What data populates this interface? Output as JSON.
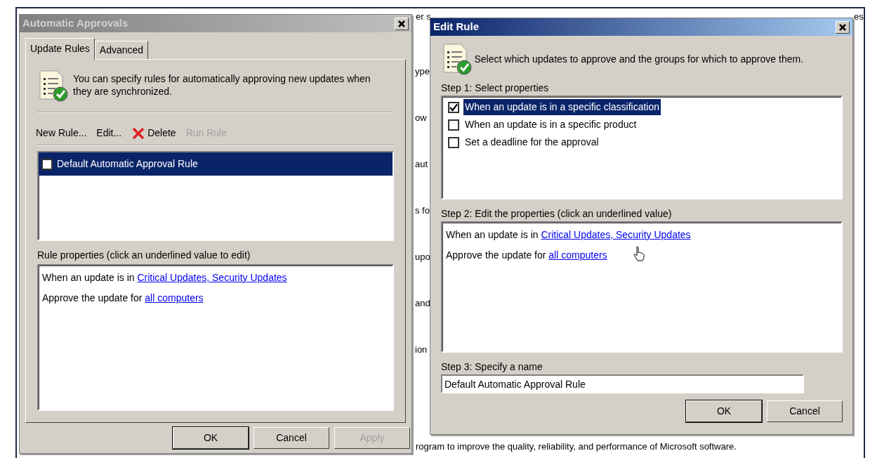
{
  "background": {
    "top_fragments": [
      "er s",
      "es"
    ],
    "side_fragments": [
      "ype",
      "ow",
      "aut",
      "s fo",
      "upo",
      "and",
      "ion"
    ],
    "footer_text": "rogram to improve the quality, reliability, and performance of Microsoft software."
  },
  "automatic_approvals": {
    "title": "Automatic Approvals",
    "active": false,
    "tabs": [
      {
        "label": "Update Rules",
        "selected": true
      },
      {
        "label": "Advanced",
        "selected": false
      }
    ],
    "intro": "You can specify rules for automatically approving new updates when they are synchronized.",
    "toolbar": [
      {
        "label": "New Rule...",
        "kind": "text",
        "disabled": false
      },
      {
        "label": "Edit...",
        "kind": "text",
        "disabled": false
      },
      {
        "label": "Delete",
        "kind": "delete",
        "disabled": false
      },
      {
        "label": "Run Rule",
        "kind": "text",
        "disabled": true
      }
    ],
    "rules": [
      {
        "label": "Default Automatic Approval Rule",
        "checked": false,
        "selected": true
      }
    ],
    "properties_label": "Rule properties (click an underlined value to edit)",
    "properties": [
      {
        "text": "When an update is in",
        "link": "Critical Updates, Security Updates"
      },
      {
        "text": "Approve the update for",
        "link": "all computers"
      }
    ],
    "buttons": [
      {
        "label": "OK",
        "default": true,
        "disabled": false
      },
      {
        "label": "Cancel",
        "default": false,
        "disabled": false
      },
      {
        "label": "Apply",
        "default": false,
        "disabled": true
      }
    ]
  },
  "edit_rule": {
    "title": "Edit Rule",
    "active": true,
    "intro": "Select which updates to approve and the groups for which to approve them.",
    "step1_label": "Step 1: Select properties",
    "options": [
      {
        "label": "When an update is in a specific classification",
        "checked": true,
        "selected": true
      },
      {
        "label": "When an update is in a specific product",
        "checked": false,
        "selected": false
      },
      {
        "label": "Set a deadline for the approval",
        "checked": false,
        "selected": false
      }
    ],
    "step2_label": "Step 2: Edit the properties (click an underlined value)",
    "properties": [
      {
        "text": "When an update is in",
        "link": "Critical Updates, Security Updates"
      },
      {
        "text": "Approve the update for",
        "link": "all computers"
      }
    ],
    "step3_label": "Step 3: Specify a name",
    "name_value": "Default Automatic Approval Rule",
    "buttons": [
      {
        "label": "OK",
        "default": true,
        "disabled": false
      },
      {
        "label": "Cancel",
        "default": false,
        "disabled": false
      }
    ]
  }
}
